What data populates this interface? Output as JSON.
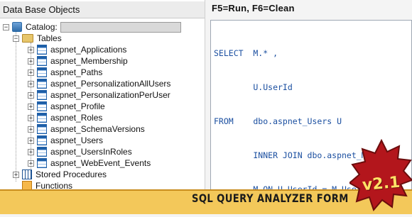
{
  "left_panel": {
    "title": "Data Base Objects",
    "catalog_label": "Catalog:",
    "tables_label": "Tables",
    "tables": [
      "aspnet_Applications",
      "aspnet_Membership",
      "aspnet_Paths",
      "aspnet_PersonalizationAllUsers",
      "aspnet_PersonalizationPerUser",
      "aspnet_Profile",
      "aspnet_Roles",
      "aspnet_SchemaVersions",
      "aspnet_Users",
      "aspnet_UsersInRoles",
      "aspnet_WebEvent_Events"
    ],
    "stored_procedures_label": "Stored Procedures",
    "functions_label": "Functions"
  },
  "editor": {
    "hint": "F5=Run, F6=Clean",
    "lines": [
      "SELECT  M.* ,",
      "        U.UserId",
      "FROM    dbo.aspnet_Users U",
      "        INNER JOIN dbo.aspnet_Membe",
      "        M ON U.UserId = M.UserId"
    ]
  },
  "banner": {
    "title": "SQL QUERY ANALYZER FORM",
    "version": "v2.1"
  },
  "colors": {
    "banner": "#f3c85a",
    "badge": "#b3161c",
    "code": "#1b4fa0"
  }
}
